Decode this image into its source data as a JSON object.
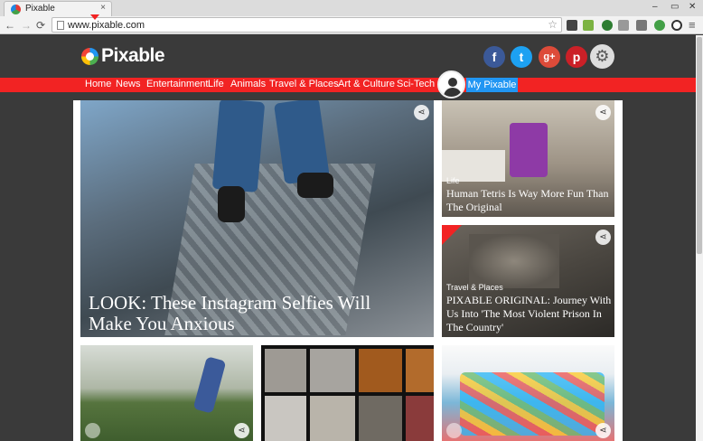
{
  "browser": {
    "tab_title": "Pixable",
    "tab_close": "×",
    "url": "www.pixable.com",
    "window_controls": [
      "–",
      "▭",
      "✕"
    ],
    "nav": {
      "back": "←",
      "forward": "→",
      "reload": "⟳",
      "menu": "≡"
    },
    "bookmark_star": "☆"
  },
  "site": {
    "logo_text": "Pixable",
    "social": [
      {
        "name": "facebook",
        "glyph": "f",
        "color": "#3b5998"
      },
      {
        "name": "twitter",
        "glyph": "t",
        "color": "#1da1f2"
      },
      {
        "name": "google-plus",
        "glyph": "g+",
        "color": "#dd4b39"
      },
      {
        "name": "pinterest",
        "glyph": "p",
        "color": "#cb2027"
      }
    ],
    "settings_glyph": "⚙",
    "nav": [
      "Home",
      "News",
      "Entertainment",
      "Life",
      "Animals",
      "Travel & Places",
      "Art & Culture",
      "Sci-Tech"
    ],
    "my_pixable": "My Pixable",
    "accent_color": "#f22323"
  },
  "cards": {
    "hero": {
      "title": "LOOK: These Instagram Selfies Will Make You Anxious"
    },
    "side1": {
      "category": "Life",
      "title": "Human Tetris Is Way More Fun Than The Original"
    },
    "side2": {
      "category": "Travel & Places",
      "title": "PIXABLE ORIGINAL: Journey With Us Into 'The Most Violent Prison In The Country'"
    }
  },
  "share_glyph": "⋖"
}
